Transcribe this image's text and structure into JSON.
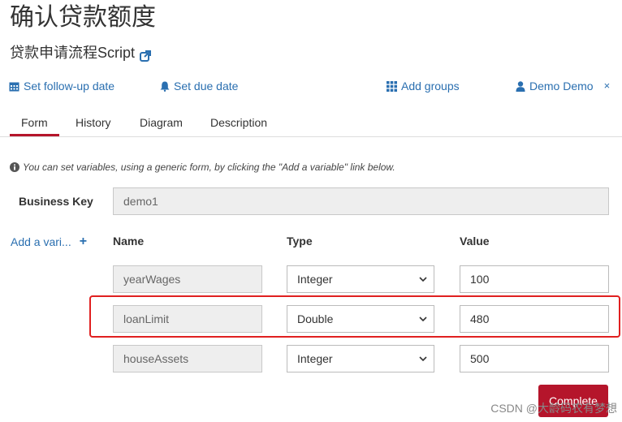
{
  "header": {
    "title": "确认贷款额度",
    "subtitle": "贷款申请流程Script"
  },
  "actions": {
    "follow_up": "Set follow-up date",
    "due_date": "Set due date",
    "add_groups": "Add groups",
    "assignee": "Demo Demo",
    "assignee_remove": "×"
  },
  "tabs": [
    "Form",
    "History",
    "Diagram",
    "Description"
  ],
  "form": {
    "info_text": "You can set variables, using a generic form, by clicking the \"Add a variable\" link below.",
    "business_key_label": "Business Key",
    "business_key_value": "demo1",
    "add_variable": "Add a vari...",
    "columns": {
      "name": "Name",
      "type": "Type",
      "value": "Value"
    },
    "variables": [
      {
        "name": "yearWages",
        "type": "Integer",
        "value": "100"
      },
      {
        "name": "loanLimit",
        "type": "Double",
        "value": "480"
      },
      {
        "name": "houseAssets",
        "type": "Integer",
        "value": "500"
      }
    ],
    "complete_label": "Complete"
  },
  "watermark": "CSDN @大龄码农有梦想",
  "colors": {
    "accent": "#b5152b",
    "link": "#2a6fb0",
    "highlight": "#e02020"
  }
}
